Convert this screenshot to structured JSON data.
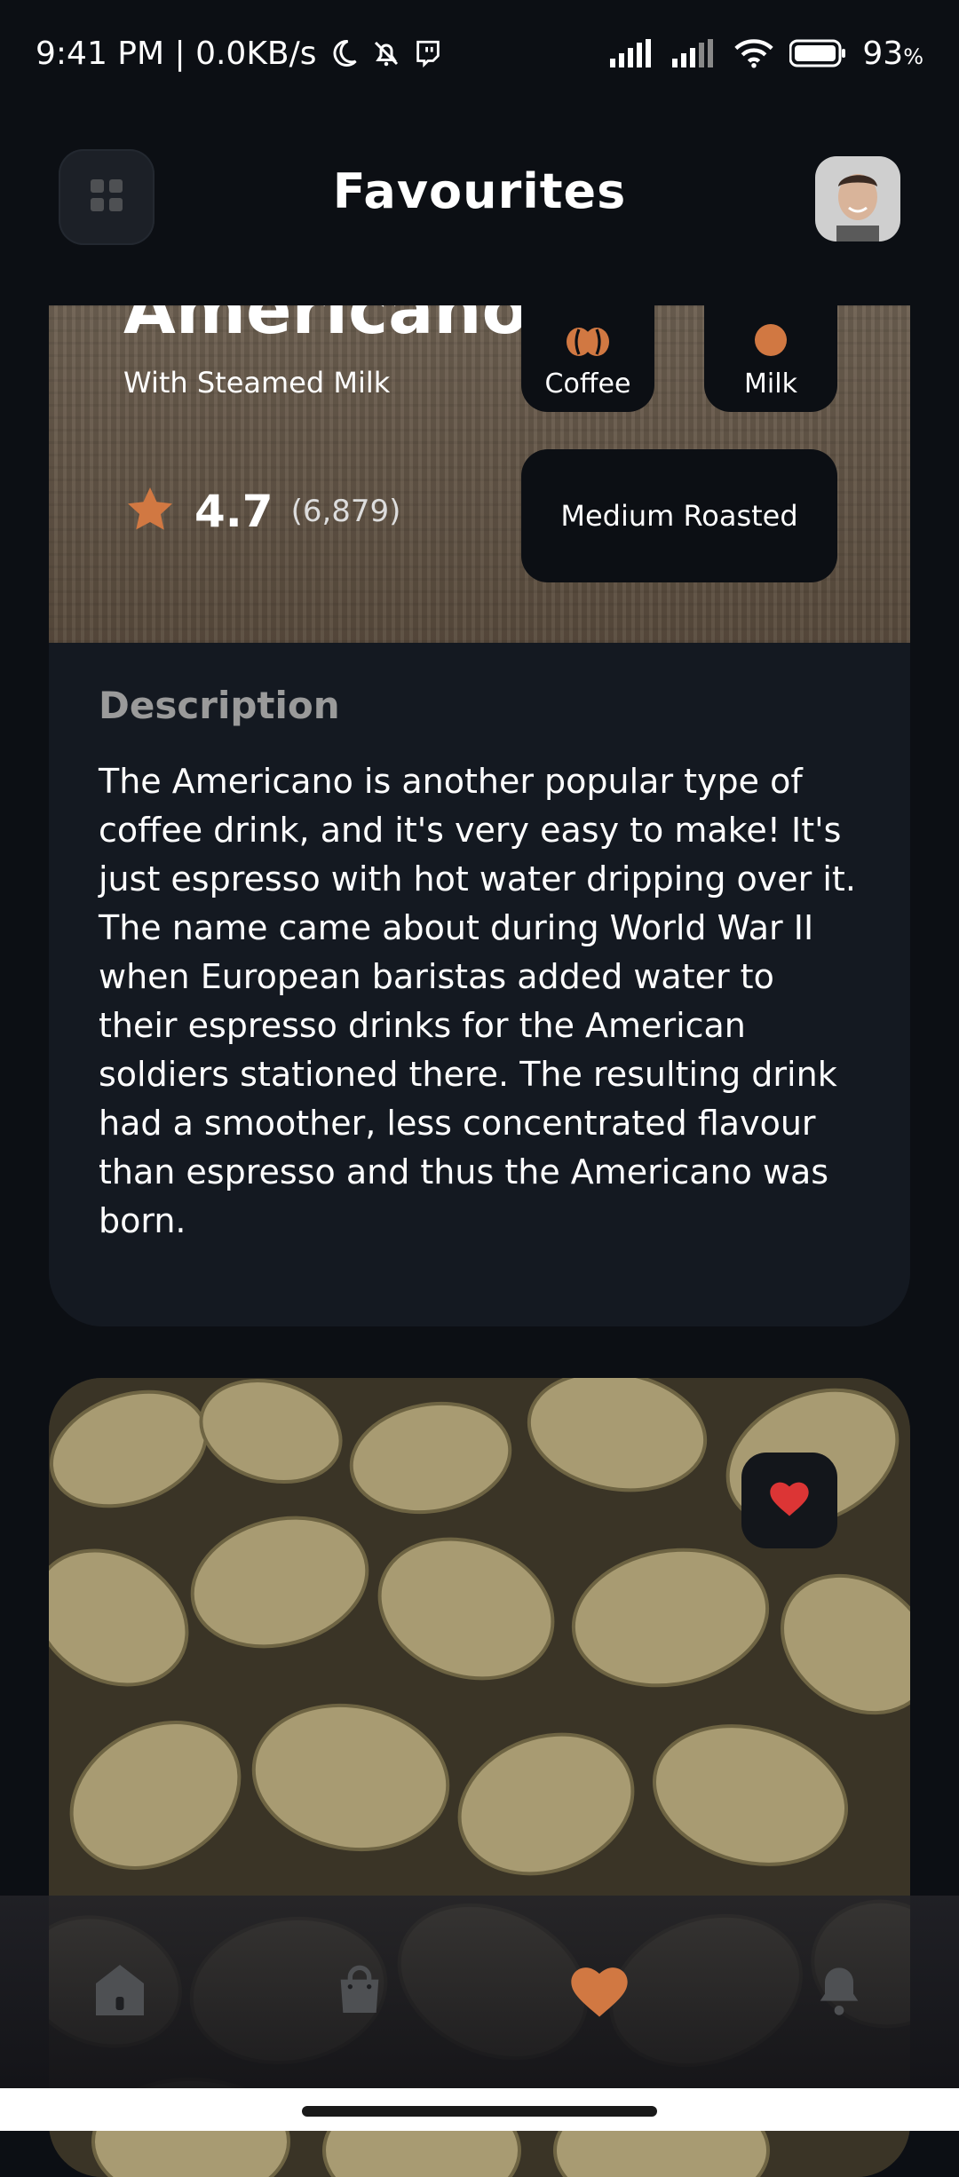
{
  "status_bar": {
    "time": "9:41 PM | 0.0KB/s",
    "battery_percent": "93",
    "battery_suffix": "%",
    "icons": [
      "moon-icon",
      "bell-off-icon",
      "twitch-icon",
      "signal-icon",
      "signal-icon",
      "wifi-icon",
      "battery-icon"
    ]
  },
  "header": {
    "title": "Favourites",
    "menu_icon": "grid-icon",
    "avatar_icon": "profile-avatar"
  },
  "card1": {
    "name": "Americano",
    "subtitle": "With Steamed Milk",
    "rating": "4.7",
    "rating_count": "(6,879)",
    "chips": {
      "coffee": "Coffee",
      "milk": "Milk",
      "roast": "Medium Roasted"
    },
    "description_heading": "Description",
    "description": "The Americano is another popular type of coffee drink, and it's very easy to make! It's just espresso with hot water dripping over it. The name came about during World War II when European baristas added water to their espresso drinks for the American soldiers stationed there. The resulting drink had a smoother, less concentrated flavour than espresso and thus the Americano was born."
  },
  "card2": {
    "image": "coffee-beans-image",
    "favourite": true
  },
  "bottom_nav": {
    "items": [
      {
        "icon": "home-icon",
        "active": false
      },
      {
        "icon": "bag-icon",
        "active": false
      },
      {
        "icon": "heart-icon",
        "active": true
      },
      {
        "icon": "bell-icon",
        "active": false
      }
    ]
  },
  "colors": {
    "accent": "#d17842",
    "background": "#0c0f14",
    "card": "#141921",
    "inactive_icon": "#4e5053",
    "favourite_red": "#dc3535"
  }
}
